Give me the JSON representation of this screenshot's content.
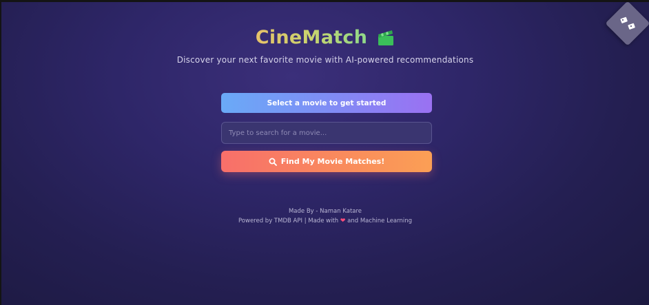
{
  "header": {
    "title": "CineMatch",
    "subtitle": "Discover your next favorite movie with AI-powered recommendations",
    "title_icon": "clapperboard-icon"
  },
  "selection": {
    "banner_text": "Select a movie to get started"
  },
  "search": {
    "placeholder": "Type to search for a movie..."
  },
  "actions": {
    "find_label": "Find My Movie Matches!",
    "find_icon": "search-icon"
  },
  "footer": {
    "made_by": "Made By - Naman Katare",
    "powered_prefix": "Powered by TMDB API | Made with",
    "powered_suffix": "and Machine Learning",
    "heart_glyph": "❤"
  },
  "corner": {
    "icon": "theme-toggle-icon"
  },
  "colors": {
    "background": "#2e2668",
    "title_gradient_start": "#e7c26a",
    "title_gradient_end": "#8fd98a",
    "banner_gradient_start": "#6aaaf7",
    "banner_gradient_end": "#9a71f2",
    "button_gradient_start": "#f86f6a",
    "button_gradient_end": "#fb9f55",
    "heart": "#ff4d7a"
  }
}
